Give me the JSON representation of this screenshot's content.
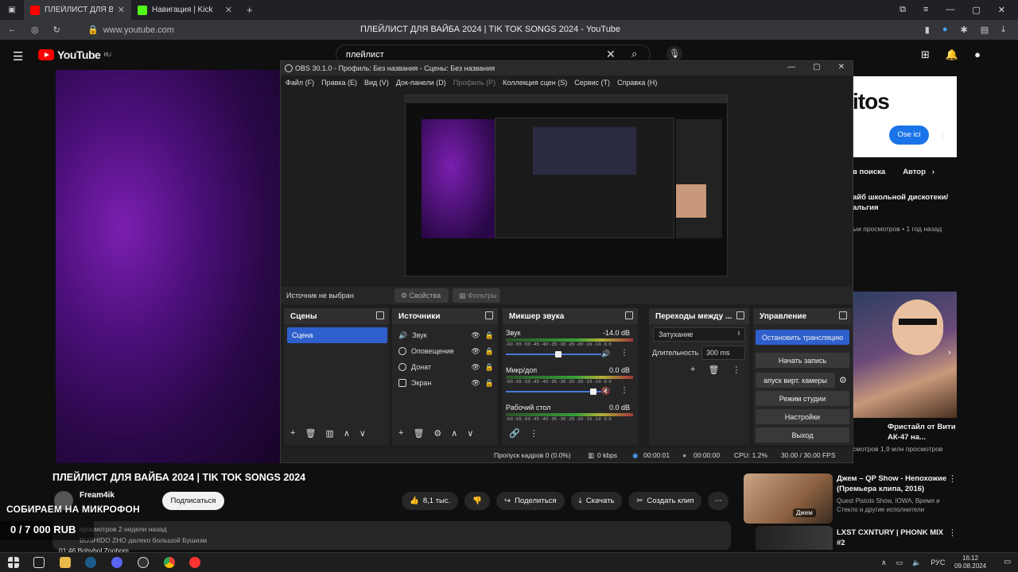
{
  "browser": {
    "tabs": [
      {
        "title": "ПЛЕЙЛИСТ ДЛЯ ВАЙБА",
        "active": true,
        "color": "#ff0000"
      },
      {
        "title": "Навигация | Kick",
        "active": false,
        "color": "#53fc18"
      }
    ],
    "new_tab": "+",
    "url": "www.youtube.com",
    "page_title": "ПЛЕЙЛИСТ ДЛЯ ВАЙБА 2024 | TIK TOK SONGS 2024 - YouTube"
  },
  "youtube": {
    "logo_text": "YouTube",
    "logo_region": "RU",
    "search_value": "плейлист",
    "video_title": "ПЛЕЙЛИСТ ДЛЯ ВАЙБА 2024 | TIK TOK SONGS 2024",
    "channel": "Fream4ik",
    "subscribe": "Подписаться",
    "likes": "8,1 тыс.",
    "share": "Поделиться",
    "download": "Скачать",
    "clip": "Создать клип",
    "desc_meta": "просмотров  2 недели назад",
    "desc_line2": "BUSHIDO ZHO  далеко большой Бушизм",
    "desc_line3": "01:46  Bobybol  Zoobom"
  },
  "overlay": {
    "goal_title": "СОБИРАЕМ НА МИКРОФОН",
    "goal_amount": "0 / 7 000 RUB"
  },
  "sidebar": {
    "banner_brand": "itos",
    "banner_button": "Ose ici",
    "chips": [
      "в поиска",
      "Автор"
    ],
    "item1_title": "айб школьной дискотеки/ альгия",
    "item1_meta": "ыи просмотров • 1 год назад",
    "item2_title": "Фристайл от Вити АК-47 на...",
    "item2_meta": "смотров     1,9 млн просмотров",
    "item3_title": "Джем – QP Show - Непохожие (Премьера клипа, 2016)",
    "item3_meta": "Quest Pistols Show, IOWA, Время и Стекло и другие исполнители",
    "item3_label": "Джем",
    "item4_title": "LXST CXNTURY | PHONK MIX #2"
  },
  "obs": {
    "title": "OBS 30.1.0 - Профиль: Без названия - Сцены: Без названия",
    "menu": [
      "Файл (F)",
      "Правка (E)",
      "Вид (V)",
      "Док-панели (D)",
      "Профиль (P)",
      "Коллекция сцен (S)",
      "Сервис (T)",
      "Справка (H)"
    ],
    "no_source": "Источник не выбран",
    "properties": "Свойства",
    "filters": "Фильтры",
    "docks": {
      "scenes": "Сцены",
      "sources": "Источники",
      "mixer": "Микшер звука",
      "transitions": "Переходы между ...",
      "controls": "Управление"
    },
    "scene_items": [
      "Сцена"
    ],
    "sources": [
      "Звук",
      "Оповещение",
      "Донат",
      "Экран"
    ],
    "mixer": [
      {
        "name": "Звук",
        "db": "-14.0 dB",
        "level": 0.55
      },
      {
        "name": "Микр/доп",
        "db": "0.0 dB",
        "level": 0.92
      },
      {
        "name": "Рабочий стол",
        "db": "0.0 dB",
        "level": 0.9
      }
    ],
    "mixer_scale": "-60 -55 -50 -45 -40 -35 -30 -25 -20 -15 -10 -5 0",
    "transition": "Затухание",
    "duration_label": "Длительность",
    "duration": "300 ms",
    "controls": [
      "Остановить трансляцию",
      "Начать запись",
      "апуск вирт. камеры",
      "Режим студии",
      "Настройки",
      "Выход"
    ],
    "status": {
      "dropped": "Пропуск кадров 0 (0.0%)",
      "kbps": "0 kbps",
      "stream_time": "00:00:01",
      "rec_time": "00:00:00",
      "cpu": "CPU: 1.2%",
      "fps": "30.00 / 30.00 FPS"
    }
  },
  "taskbar": {
    "lang": "РУС",
    "time": "16:12",
    "date": "09.08.2024"
  },
  "colors": {
    "obs_accent": "#2f5fcc",
    "yt_red": "#ff0000"
  }
}
